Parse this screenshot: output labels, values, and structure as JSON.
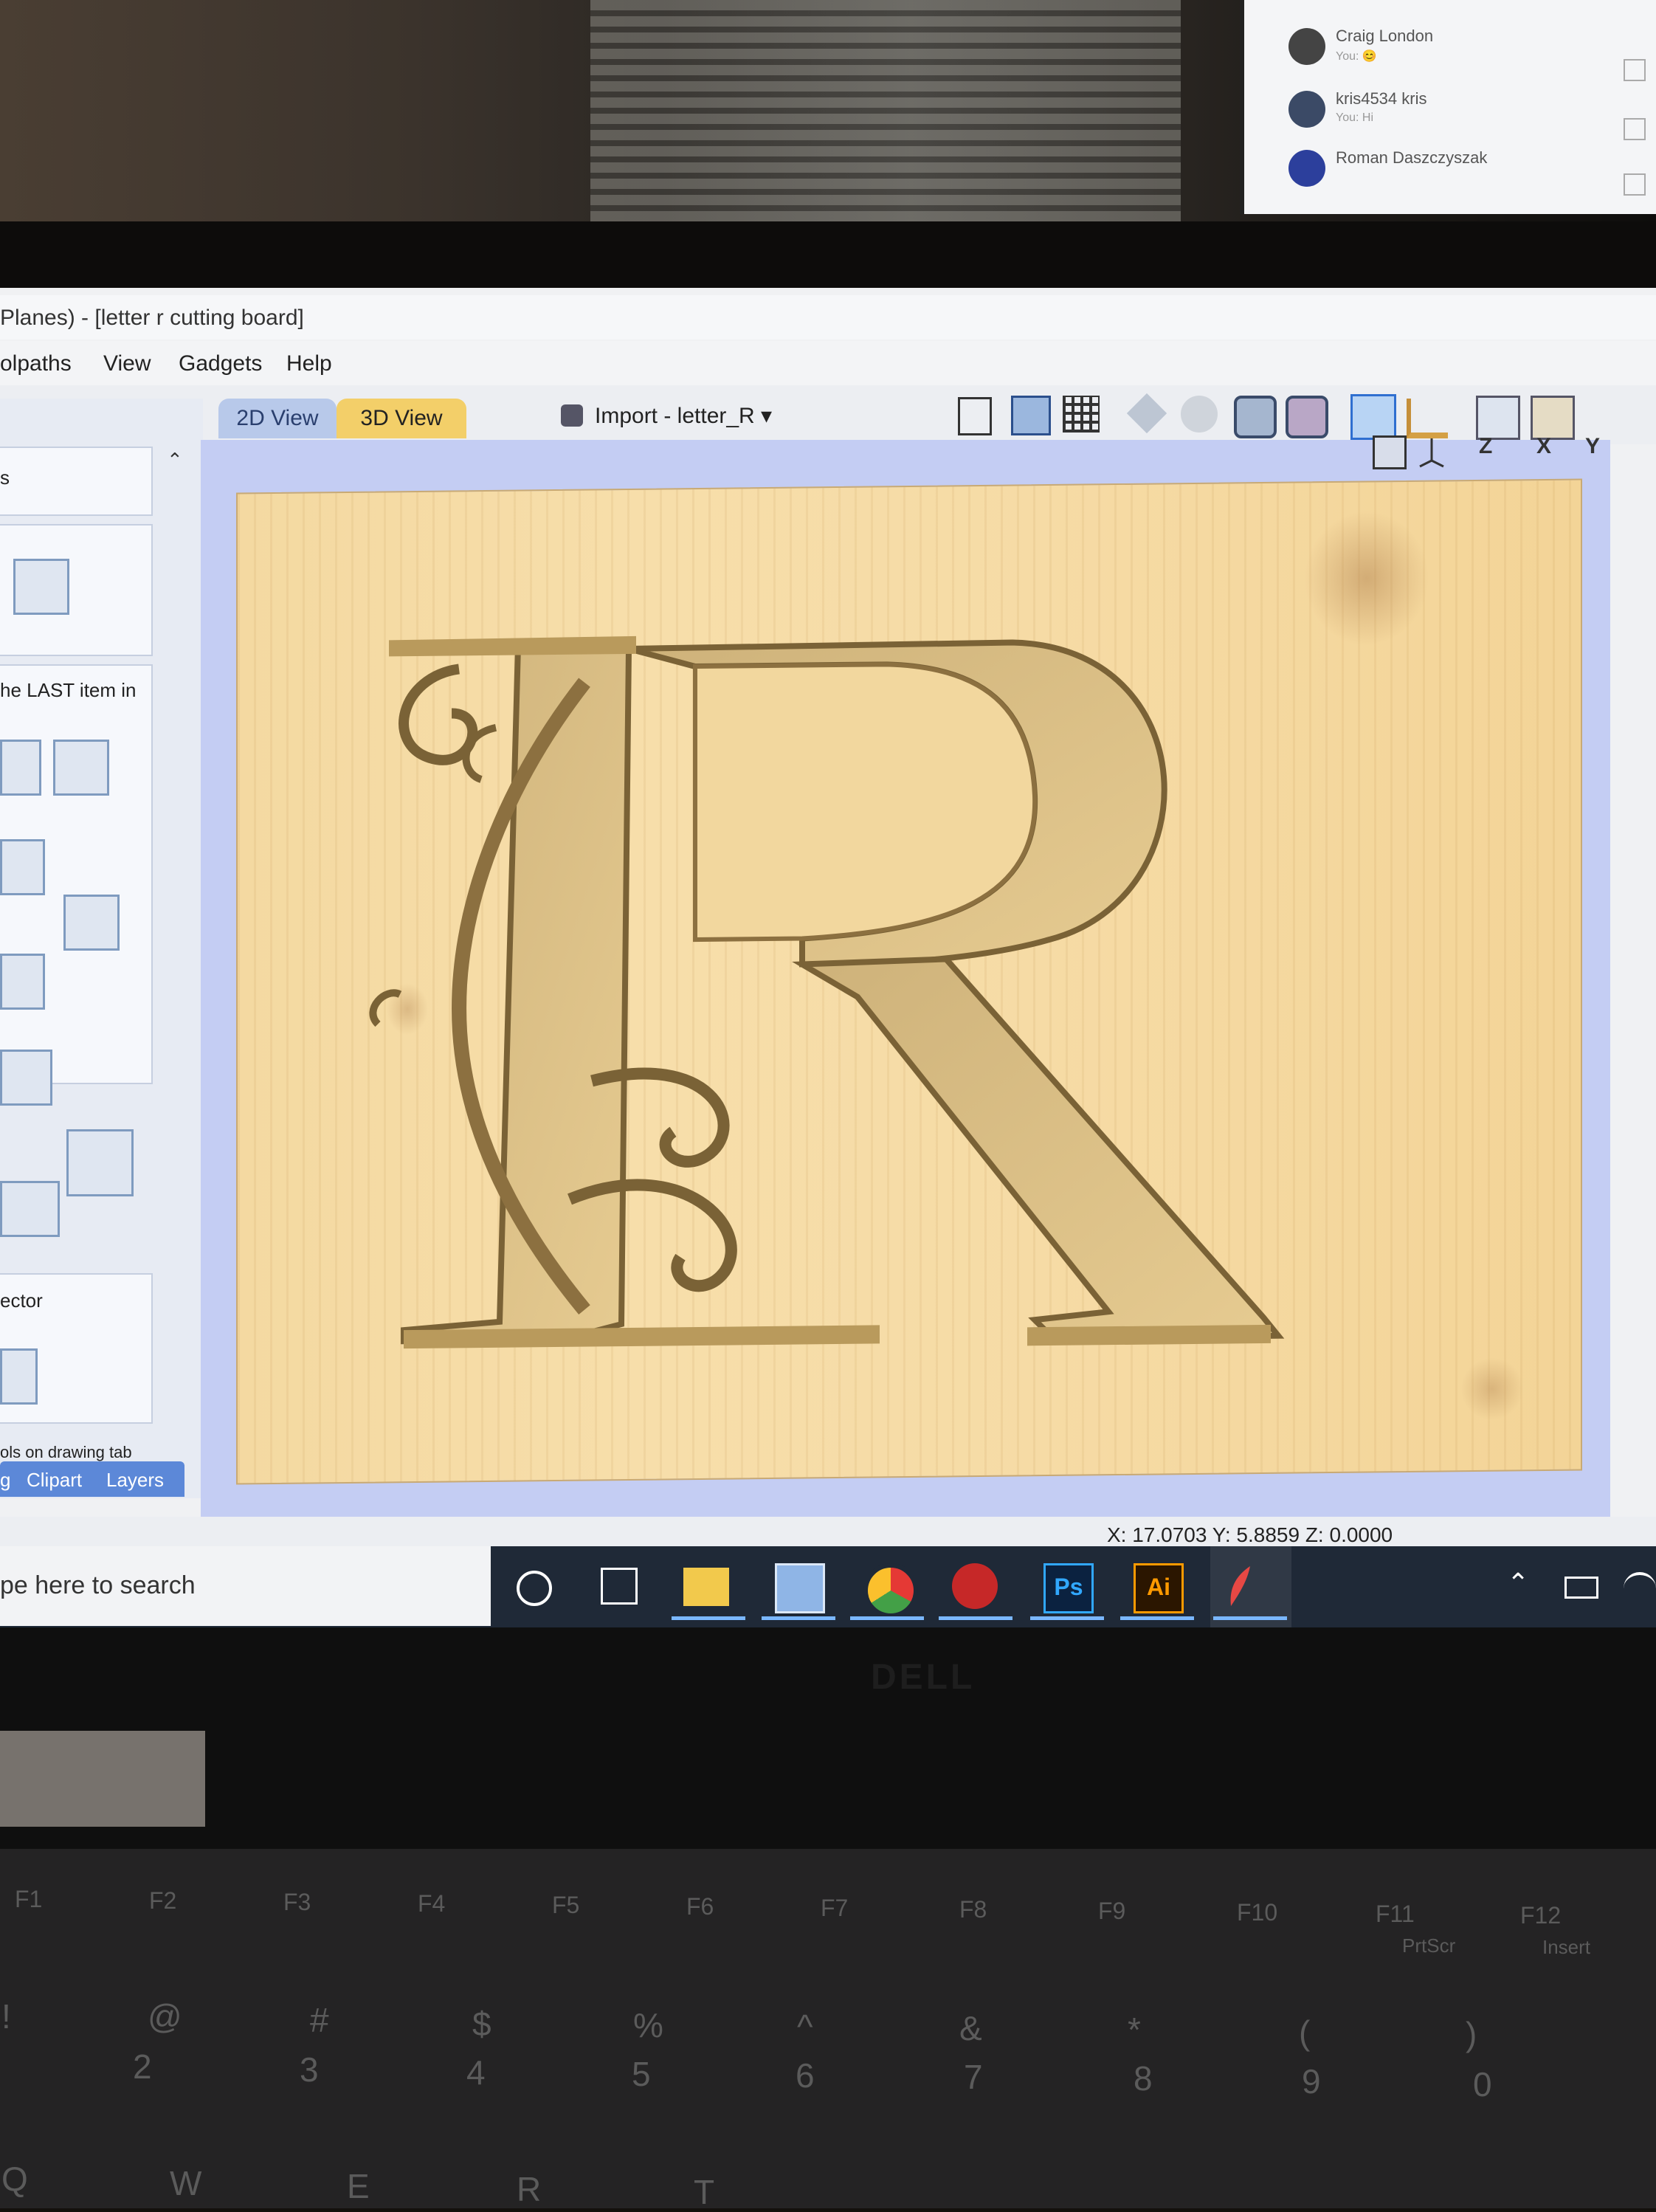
{
  "chat": {
    "contacts": [
      {
        "name": "Craig London",
        "message": "You: 😊"
      },
      {
        "name": "kris4534 kris",
        "message": "You: Hi"
      },
      {
        "name": "Roman Daszczyszak",
        "message": ""
      }
    ]
  },
  "window": {
    "title": "Planes) - [letter r cutting board]"
  },
  "menu": {
    "items": [
      "olpaths",
      "View",
      "Gadgets",
      "Help"
    ]
  },
  "tabs": {
    "tab_2d": "2D View",
    "tab_3d": "3D View",
    "import_label": "Import - letter_R ▾"
  },
  "left_panel": {
    "text1": "s",
    "text2": "he LAST item in",
    "text3": "ector",
    "text4": "ols on drawing tab",
    "bottom_tabs": [
      "g",
      "Clipart",
      "Layers"
    ]
  },
  "axis_buttons": [
    "Z",
    "X",
    "Y"
  ],
  "status": {
    "coords": "X: 17.0703 Y:  5.8859 Z:  0.0000"
  },
  "taskbar": {
    "search_placeholder": "pe here to search",
    "ps_label": "Ps",
    "ai_label": "Ai"
  },
  "laptop": {
    "brand": "DELL",
    "fkeys": [
      "F1",
      "F2",
      "F3",
      "F4",
      "F5",
      "F6",
      "F7",
      "F8",
      "F9",
      "F10",
      "F11",
      "F12"
    ],
    "fkey_sub": [
      "PrtScr",
      "Insert"
    ],
    "number_row": [
      "2",
      "3",
      "4",
      "5",
      "6",
      "7",
      "8",
      "9",
      "0"
    ],
    "symbol_row": [
      "!",
      "@",
      "#",
      "$",
      "%",
      "^",
      "&",
      "*",
      "(",
      ")"
    ],
    "letters": [
      "Q",
      "W",
      "E",
      "R",
      "T"
    ]
  },
  "colors": {
    "viewport_bg": "#c4cdf3",
    "wood": "#f5d9a2",
    "tab_active": "#f3cf69",
    "tab_inactive": "#b8c9ea",
    "taskbar": "#1f2937"
  }
}
